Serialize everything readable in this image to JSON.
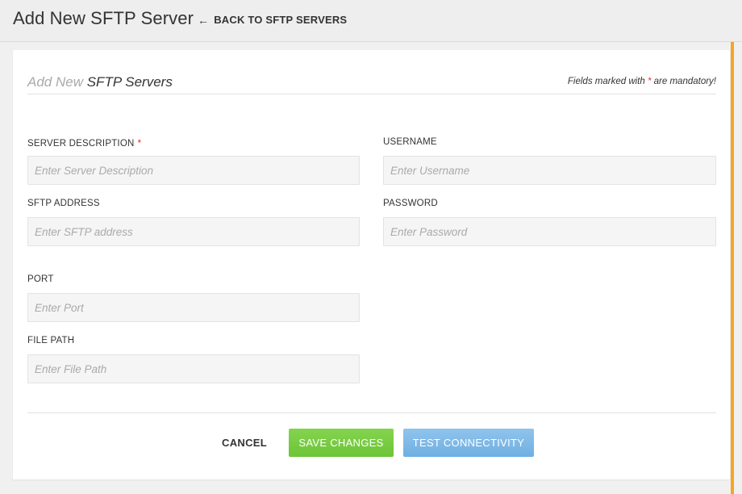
{
  "header": {
    "title": "Add New SFTP Server",
    "back_arrow": "←",
    "back_label": "BACK TO SFTP SERVERS"
  },
  "card": {
    "title_prefix": "Add New",
    "title_main": "SFTP Servers",
    "mandatory_note_before": "Fields marked with ",
    "mandatory_note_star": "*",
    "mandatory_note_after": " are mandatory!"
  },
  "fields": {
    "server_description": {
      "label": "SERVER DESCRIPTION",
      "required_marker": "*",
      "placeholder": "Enter Server Description",
      "value": ""
    },
    "username": {
      "label": "USERNAME",
      "placeholder": "Enter Username",
      "value": ""
    },
    "sftp_address": {
      "label": "SFTP ADDRESS",
      "placeholder": "Enter SFTP address",
      "value": ""
    },
    "password": {
      "label": "PASSWORD",
      "placeholder": "Enter Password",
      "value": ""
    },
    "port": {
      "label": "PORT",
      "placeholder": "Enter Port",
      "value": ""
    },
    "file_path": {
      "label": "FILE PATH",
      "placeholder": "Enter File Path",
      "value": ""
    }
  },
  "actions": {
    "cancel": "CANCEL",
    "save": "SAVE CHANGES",
    "test": "TEST CONNECTIVITY"
  },
  "colors": {
    "accent": "#f5a623",
    "save_button": "#6cc537",
    "test_button": "#6fafe2",
    "required": "#d9332c"
  }
}
